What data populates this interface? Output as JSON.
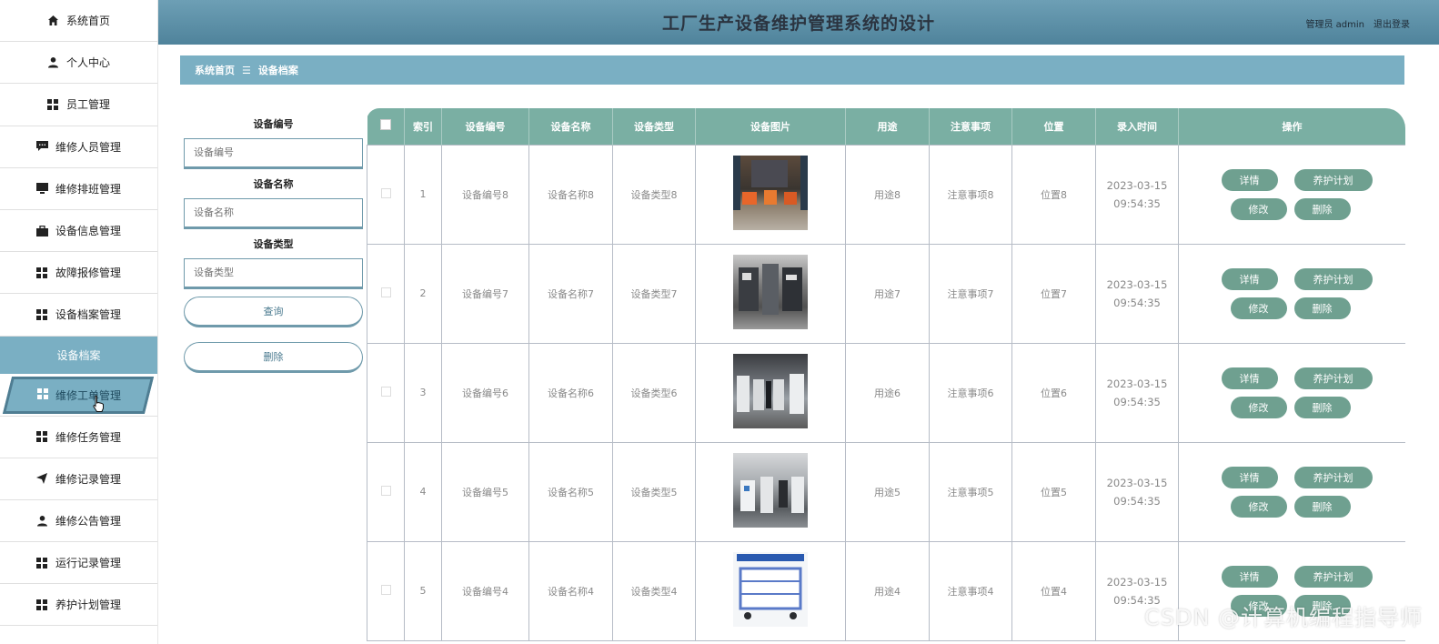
{
  "header": {
    "title": "工厂生产设备维护管理系统的设计",
    "user_label": "管理员 admin",
    "logout_label": "退出登录"
  },
  "sidebar": {
    "items_top": [
      {
        "label": "系统首页",
        "icon": "home-icon"
      },
      {
        "label": "个人中心",
        "icon": "person-icon"
      },
      {
        "label": "员工管理",
        "icon": "grid-icon"
      },
      {
        "label": "维修人员管理",
        "icon": "chat-icon"
      },
      {
        "label": "维修排班管理",
        "icon": "monitor-icon"
      },
      {
        "label": "设备信息管理",
        "icon": "briefcase-icon"
      },
      {
        "label": "故障报修管理",
        "icon": "grid-icon"
      },
      {
        "label": "设备档案管理",
        "icon": "grid-icon"
      }
    ],
    "sub_item": "设备档案",
    "active_item": {
      "label": "维修工单管理",
      "icon": "grid-icon"
    },
    "items_bottom": [
      {
        "label": "维修任务管理",
        "icon": "grid-icon"
      },
      {
        "label": "维修记录管理",
        "icon": "send-icon"
      },
      {
        "label": "维修公告管理",
        "icon": "person-icon"
      },
      {
        "label": "运行记录管理",
        "icon": "grid-icon"
      },
      {
        "label": "养护计划管理",
        "icon": "grid-icon"
      }
    ]
  },
  "breadcrumb": {
    "home": "系统首页",
    "separator": "☰",
    "current": "设备档案"
  },
  "search": {
    "fields": [
      {
        "label": "设备编号",
        "placeholder": "设备编号"
      },
      {
        "label": "设备名称",
        "placeholder": "设备名称"
      },
      {
        "label": "设备类型",
        "placeholder": "设备类型"
      }
    ],
    "query_button": "查询",
    "delete_button": "删除"
  },
  "table": {
    "headers": [
      "索引",
      "设备编号",
      "设备名称",
      "设备类型",
      "设备图片",
      "用途",
      "注意事项",
      "位置",
      "录入时间",
      "操作"
    ],
    "rows": [
      {
        "index": "1",
        "code": "设备编号8",
        "name": "设备名称8",
        "type": "设备类型8",
        "use": "用途8",
        "notes": "注意事项8",
        "location": "位置8",
        "date": "2023-03-15",
        "time": "09:54:35"
      },
      {
        "index": "2",
        "code": "设备编号7",
        "name": "设备名称7",
        "type": "设备类型7",
        "use": "用途7",
        "notes": "注意事项7",
        "location": "位置7",
        "date": "2023-03-15",
        "time": "09:54:35"
      },
      {
        "index": "3",
        "code": "设备编号6",
        "name": "设备名称6",
        "type": "设备类型6",
        "use": "用途6",
        "notes": "注意事项6",
        "location": "位置6",
        "date": "2023-03-15",
        "time": "09:54:35"
      },
      {
        "index": "4",
        "code": "设备编号5",
        "name": "设备名称5",
        "type": "设备类型5",
        "use": "用途5",
        "notes": "注意事项5",
        "location": "位置5",
        "date": "2023-03-15",
        "time": "09:54:35"
      },
      {
        "index": "5",
        "code": "设备编号4",
        "name": "设备名称4",
        "type": "设备类型4",
        "use": "用途4",
        "notes": "注意事项4",
        "location": "位置4",
        "date": "2023-03-15",
        "time": "09:54:35"
      }
    ],
    "actions": {
      "detail": "详情",
      "plan": "养护计划",
      "edit": "修改",
      "delete": "删除"
    }
  },
  "watermark": "CSDN @计算机编程指导师",
  "colors": {
    "header": "#5a8ea6",
    "accent": "#7aafc3",
    "table_head": "#7aafa3",
    "button": "#6fa090"
  }
}
